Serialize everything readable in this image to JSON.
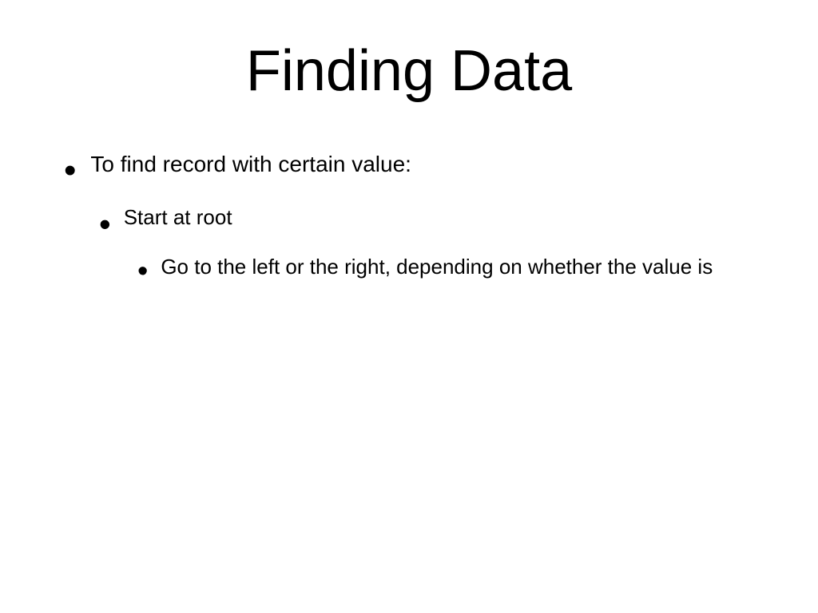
{
  "title": "Finding Data",
  "body": {
    "level1": "To find record with certain value:",
    "level2": "Start at root",
    "level3": "Go to the left or the right, depending on whether the value is"
  }
}
